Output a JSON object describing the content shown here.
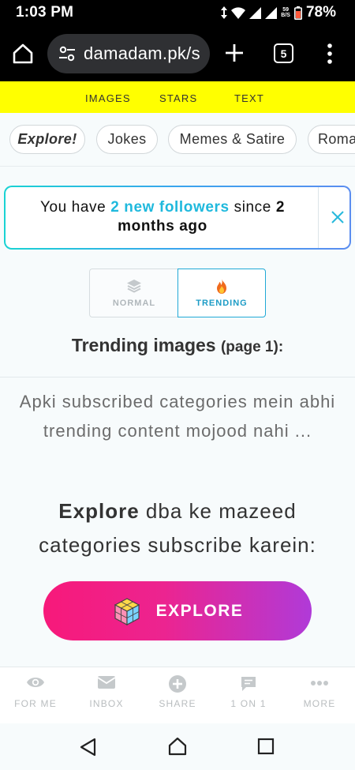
{
  "status_bar": {
    "time": "1:03 PM",
    "net_speed_top": "59",
    "net_speed_bottom": "B/S",
    "battery": "78%"
  },
  "browser": {
    "url": "damadam.pk/s",
    "tab_count": "5",
    "icons": [
      "home-icon",
      "site-settings-icon",
      "new-tab-plus-icon",
      "tab-switcher-icon",
      "overflow-menu-icon"
    ]
  },
  "top_nav": {
    "items": [
      "IMAGES",
      "STARS",
      "TEXT"
    ],
    "background": "#ffff00"
  },
  "categories": {
    "items": [
      "Explore!",
      "Jokes",
      "Memes & Satire",
      "Roma"
    ]
  },
  "notice": {
    "prefix": "You have",
    "highlight": "2 new followers",
    "middle": "since",
    "count": "2",
    "suffix": "months ago",
    "highlight_color": "#1fb9dd"
  },
  "mode_toggle": {
    "normal_label": "NORMAL",
    "trending_label": "TRENDING",
    "selected": "TRENDING"
  },
  "trending": {
    "title": "Trending images",
    "page_text": "(page 1):"
  },
  "empty_state": {
    "line1": "Apki subscribed categories mein abhi",
    "line2": "trending content mojood nahi ..."
  },
  "explore_prompt": {
    "bold": "Explore",
    "rest": "dba ke mazeed categories subscribe karein:"
  },
  "explore_button": {
    "label": "EXPLORE"
  },
  "bottom_nav": {
    "items": [
      "FOR ME",
      "INBOX",
      "SHARE",
      "1 ON 1",
      "MORE"
    ]
  }
}
